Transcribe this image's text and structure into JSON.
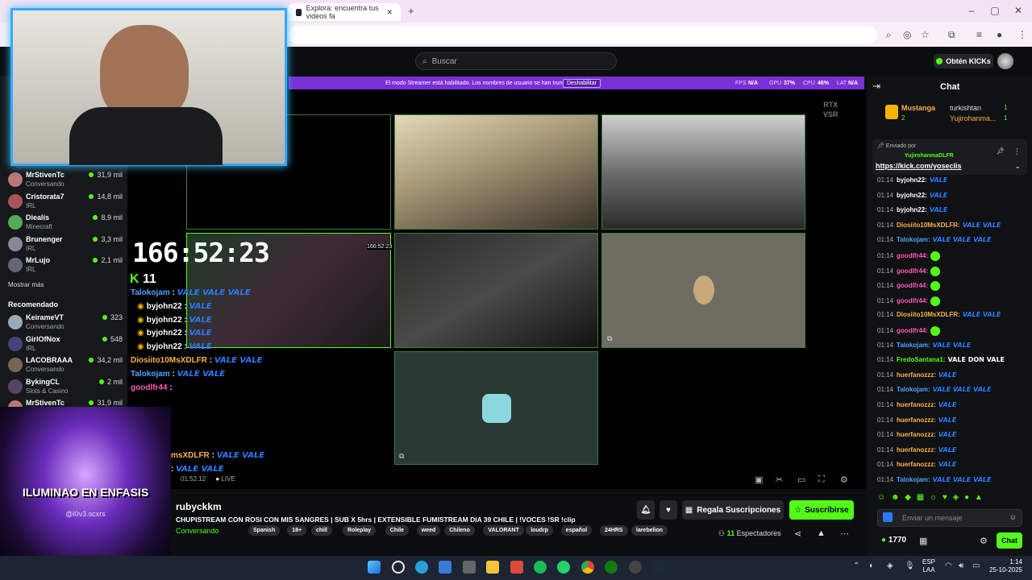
{
  "browser": {
    "tab_title": "Explora: encuentra tus videos fa",
    "new_tab": "+"
  },
  "header": {
    "search_placeholder": "Buscar",
    "get_kicks": "Obtén KICKs"
  },
  "streamer_bar": {
    "message": "El modo Streamer está habilitado. Los nombres de usuario se han truncado.",
    "disable": "Deshabilitar",
    "fps_label": "FPS",
    "fps": "N/A",
    "gpu_label": "GPU",
    "gpu": "37%",
    "cpu_label": "CPU",
    "cpu": "46%",
    "lat_label": "LAT",
    "lat": "N/A"
  },
  "sidebar": {
    "channels": [
      {
        "name": "MrStivenTc",
        "category": "Conversando",
        "viewers": "31,9 mil",
        "color": "#b77"
      },
      {
        "name": "Cristorata7",
        "category": "IRL",
        "viewers": "14,8 mil",
        "color": "#a55"
      },
      {
        "name": "Diealis",
        "category": "Minecraft",
        "viewers": "8,9 mil",
        "color": "#5a5"
      },
      {
        "name": "Brunenger",
        "category": "IRL",
        "viewers": "3,3 mil",
        "color": "#889"
      },
      {
        "name": "MrLujo",
        "category": "IRL",
        "viewers": "2,1 mil",
        "color": "#667"
      }
    ],
    "show_more": "Mostrar más",
    "recommended_header": "Recomendado",
    "recommended": [
      {
        "name": "KeirameVT",
        "category": "Conversando",
        "viewers": "323",
        "color": "#9ab"
      },
      {
        "name": "GirlOfNox",
        "category": "IRL",
        "viewers": "548",
        "color": "#447"
      },
      {
        "name": "LACOBRAAA",
        "category": "Conversando",
        "viewers": "34,2 mil",
        "color": "#765"
      },
      {
        "name": "BykingCL",
        "category": "Slots & Casino",
        "viewers": "2 mil",
        "color": "#546"
      },
      {
        "name": "MrStivenTc",
        "category": "",
        "viewers": "31,9 mil",
        "color": "#b77"
      }
    ]
  },
  "video": {
    "rtx": "RTX",
    "vsr": "VSR",
    "timer": "166:52:23",
    "sub_count": "11",
    "mini_timer": "166:52:23",
    "overlay_title": "ILUMINAO EN ENFASIS",
    "overlay_handle": "@l0v3.scxrs",
    "live": "LIVE",
    "time_small": "01:52:12"
  },
  "overlay_chat": [
    {
      "user": "Talokojam",
      "msg": "VALE VALE VALE",
      "color": "#4fa3ff"
    },
    {
      "user": "byjohn22",
      "msg": "VALE",
      "color": "#fff"
    },
    {
      "user": "byjohn22",
      "msg": "VALE",
      "color": "#fff"
    },
    {
      "user": "byjohn22",
      "msg": "VALE",
      "color": "#fff"
    },
    {
      "user": "byjohn22",
      "msg": "VALE",
      "color": "#fff"
    },
    {
      "user": "Diosiito10MsXDLFR",
      "msg": "VALE VALE",
      "color": "#ffb04a"
    },
    {
      "user": "Talokojam",
      "msg": "VALE VALE",
      "color": "#4fa3ff"
    },
    {
      "user": "goodlfr44",
      "msg": "",
      "color": "#ff5ab8"
    }
  ],
  "overlay_chat_tail": [
    {
      "user": "msXDLFR",
      "msg": "VALE VALE"
    },
    {
      "user": "",
      "msg": "VALE VALE"
    }
  ],
  "stream": {
    "streamer": "rubyckkm",
    "title": "CHUPISTREAM CON ROSI CON MIS SANGRES | SUB X 5hrs | EXTENSIBLE FUMISTREAM DIA 39 CHILE | !VOCES !SR !clip",
    "category": "Conversando",
    "tags": [
      "Spanish",
      "18+",
      "chill",
      "Roleplay",
      "Chile",
      "weed",
      "Chileno",
      "VALORANT",
      "loudrp",
      "español",
      "24HRS",
      "larebelion"
    ],
    "gift_subs": "Regala Suscripciones",
    "subscribe": "Suscribirse",
    "viewers": "11",
    "viewers_label": "Espectadores"
  },
  "chat": {
    "title": "Chat",
    "top_gifters": [
      {
        "name": "Mustanga",
        "count": "2"
      },
      {
        "name": "turkishtan",
        "count": "1"
      },
      {
        "name": "Yujirohanma...",
        "count": "1"
      }
    ],
    "pinned_label": "Enviado por",
    "pinned_user": "YujirohanmaDLFR",
    "pinned_link": "https://kick.com/yoseclis",
    "messages": [
      {
        "time": "01:14",
        "user": "byjohn22:",
        "msg": "VALE",
        "color": "#fff"
      },
      {
        "time": "01:14",
        "user": "byjohn22:",
        "msg": "VALE",
        "color": "#fff"
      },
      {
        "time": "01:14",
        "user": "byjohn22:",
        "msg": "VALE",
        "color": "#fff"
      },
      {
        "time": "01:14",
        "user": "Diosiito10MsXDLFR:",
        "msg": "VALE VALE",
        "color": "#ffb04a"
      },
      {
        "time": "01:14",
        "user": "Talokojam:",
        "msg": "VALE VALE VALE",
        "color": "#4fa3ff"
      },
      {
        "time": "01:14",
        "user": "goodlfr44:",
        "msg": "",
        "color": "#ff5ab8"
      },
      {
        "time": "01:14",
        "user": "goodlfr44:",
        "msg": "",
        "color": "#ff5ab8"
      },
      {
        "time": "01:14",
        "user": "goodlfr44:",
        "msg": "",
        "color": "#ff5ab8"
      },
      {
        "time": "01:14",
        "user": "goodlfr44:",
        "msg": "",
        "color": "#ff5ab8"
      },
      {
        "time": "01:14",
        "user": "Diosiito10MsXDLFR:",
        "msg": "VALE VALE",
        "color": "#ffb04a"
      },
      {
        "time": "01:14",
        "user": "goodlfr44:",
        "msg": "",
        "color": "#ff5ab8"
      },
      {
        "time": "01:14",
        "user": "Talokojam:",
        "msg": "VALE VALE",
        "color": "#4fa3ff"
      },
      {
        "time": "01:14",
        "user": "FredoSantana1:",
        "msg": "VALE DON VALE",
        "color": "#53fc18"
      },
      {
        "time": "01:14",
        "user": "huerfanozzz:",
        "msg": "VALE",
        "color": "#ffb04a"
      },
      {
        "time": "01:14",
        "user": "Talokojam:",
        "msg": "VALE VALE VALE",
        "color": "#4fa3ff"
      },
      {
        "time": "01:14",
        "user": "huerfanozzz:",
        "msg": "VALE",
        "color": "#ffb04a"
      },
      {
        "time": "01:14",
        "user": "huerfanozzz:",
        "msg": "VALE",
        "color": "#ffb04a"
      },
      {
        "time": "01:14",
        "user": "huerfanozzz:",
        "msg": "VALE",
        "color": "#ffb04a"
      },
      {
        "time": "01:14",
        "user": "huerfanozzz:",
        "msg": "VALE",
        "color": "#ffb04a"
      },
      {
        "time": "01:14",
        "user": "huerfanozzz:",
        "msg": "VALE",
        "color": "#ffb04a"
      },
      {
        "time": "01:14",
        "user": "Talokojam:",
        "msg": "VALE VALE VALE",
        "color": "#4fa3ff"
      }
    ],
    "input_placeholder": "Enviar un mensaje",
    "kicks": "1770",
    "send": "Chat"
  },
  "taskbar": {
    "lang_top": "ESP",
    "lang_bottom": "LAA",
    "time": "1:14",
    "date": "25-10-2025"
  }
}
